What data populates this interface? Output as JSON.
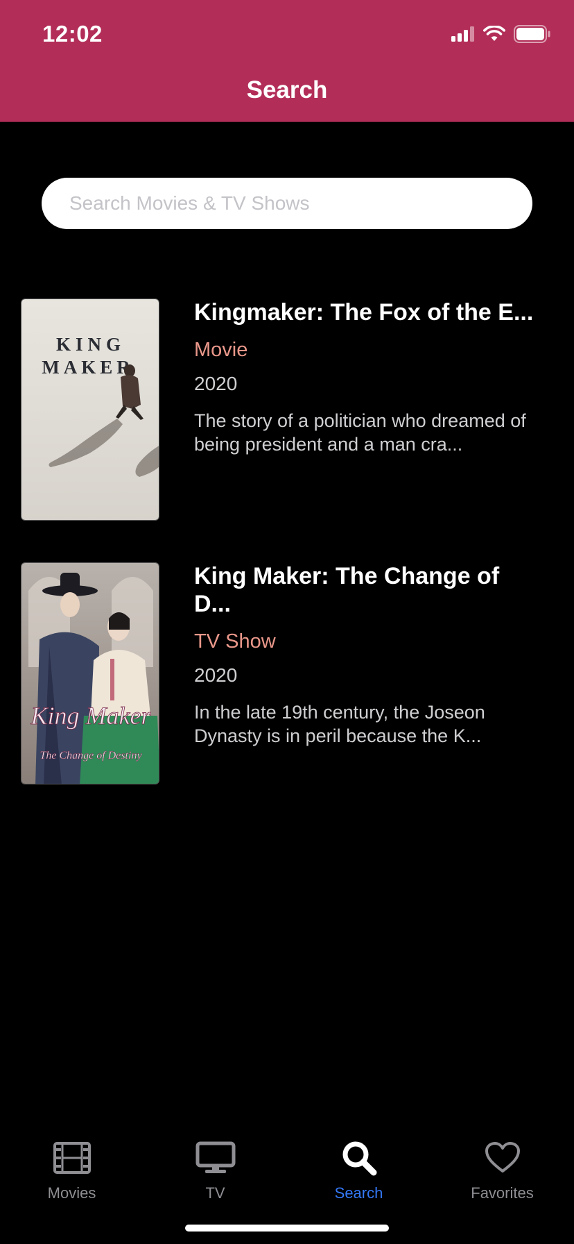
{
  "status_bar": {
    "time": "12:02",
    "icons": [
      "cellular-signal-icon",
      "wifi-icon",
      "battery-icon"
    ]
  },
  "header": {
    "title": "Search",
    "background_color": "#B22E58"
  },
  "search": {
    "placeholder": "Search Movies & TV Shows",
    "value": ""
  },
  "results": [
    {
      "poster_text_lines": [
        "KING",
        "MAKER"
      ],
      "title": "Kingmaker: The Fox of the E...",
      "type": "Movie",
      "year": "2020",
      "description": "The story of a politician who dreamed of being president and a man cra..."
    },
    {
      "poster_text_lines": [
        "King Maker",
        "The Change of Destiny"
      ],
      "title": "King Maker: The Change of D...",
      "type": "TV Show",
      "year": "2020",
      "description": "In the late 19th century, the Joseon Dynasty is in peril because the K..."
    }
  ],
  "tabbar": {
    "tabs": [
      {
        "label": "Movies",
        "icon": "film-icon",
        "active": false
      },
      {
        "label": "TV",
        "icon": "tv-icon",
        "active": false
      },
      {
        "label": "Search",
        "icon": "search-icon",
        "active": true
      },
      {
        "label": "Favorites",
        "icon": "heart-icon",
        "active": false
      }
    ],
    "active_color": "#3478F6",
    "inactive_color": "#8E8E93"
  }
}
